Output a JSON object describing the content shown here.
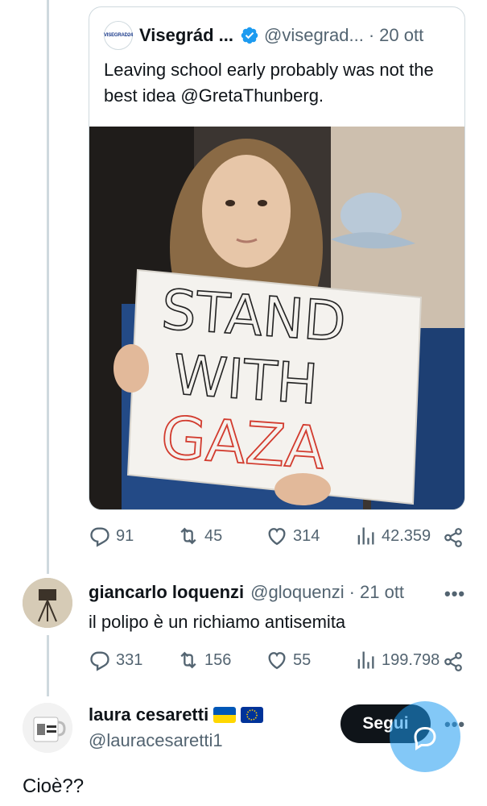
{
  "quoted_tweet": {
    "avatar_label": "VISEGRAD24",
    "name": "Visegrád ...",
    "handle": "@visegrad...",
    "separator": "·",
    "date": "20 ott",
    "text": "Leaving school early probably was not the best idea @GretaThunberg.",
    "image": {
      "sign_line_1": "STAND",
      "sign_line_2": "WITH",
      "sign_line_3": "GAZA"
    }
  },
  "quoted_actions": {
    "replies": "91",
    "reposts": "45",
    "likes": "314",
    "views": "42.359"
  },
  "reply": {
    "name": "giancarlo loquenzi",
    "handle": "@gloquenzi",
    "separator": "·",
    "date": "21 ott",
    "more": "•••",
    "text": "il polipo è un richiamo antisemita"
  },
  "reply_actions": {
    "replies": "331",
    "reposts": "156",
    "likes": "55",
    "views": "199.798"
  },
  "main_tweet": {
    "name": "laura cesaretti",
    "handle": "@lauracesaretti1",
    "follow_label": "Segui",
    "more": "•••",
    "text": "Cioè??"
  },
  "colors": {
    "accent": "#1d9bf0",
    "text": "#0f1419",
    "muted": "#536471",
    "border": "#cfd9de"
  },
  "icons": [
    "reply-icon",
    "repost-icon",
    "like-icon",
    "views-icon",
    "share-icon",
    "verified-icon",
    "more-icon",
    "compose-icon"
  ]
}
